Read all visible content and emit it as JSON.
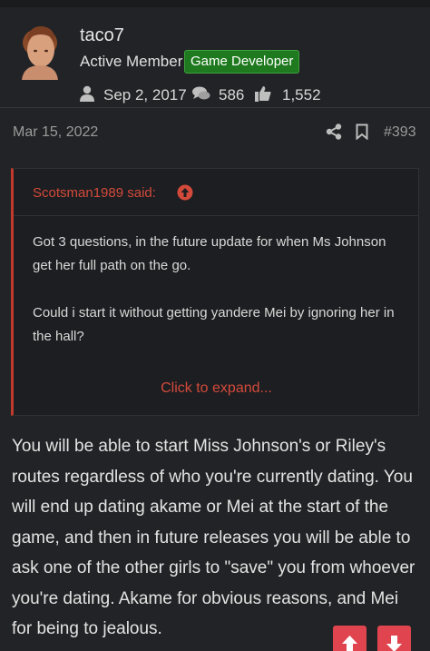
{
  "user": {
    "name": "taco7",
    "title": "Active Member",
    "badge": "Game Developer",
    "joined": "Sep 2, 2017",
    "messages": "586",
    "reactions": "1,552"
  },
  "post": {
    "date": "Mar 15, 2022",
    "number": "#393",
    "quote": {
      "author": "Scotsman1989 said:",
      "paragraphs": [
        "Got 3 questions, in the future update for when Ms Johnson get her full path on the go.",
        "Could i start it without getting yandere Mei by ignoring her in the hall?"
      ],
      "expand_label": "Click to expand..."
    },
    "body": "You will be able to start Miss Johnson's or Riley's routes regardless of who you're currently dating. You will end up dating akame or Mei at the start of the game, and then in future releases you will be able to ask one of the other girls to \"save\" you from whoever you're dating. Akame for obvious reasons, and Mei for being to jealous."
  },
  "icons": {
    "joined": "user-icon",
    "messages": "comments-icon",
    "reactions": "thumbs-up-icon",
    "share": "share-icon",
    "bookmark": "bookmark-icon",
    "quote_link": "arrow-up-circle-icon",
    "upvote": "arrow-up-icon",
    "downvote": "arrow-down-icon"
  },
  "colors": {
    "background": "#222326",
    "quote_accent": "#c0392b",
    "badge": "#1f7a1f",
    "vote_button": "#e0454f"
  }
}
